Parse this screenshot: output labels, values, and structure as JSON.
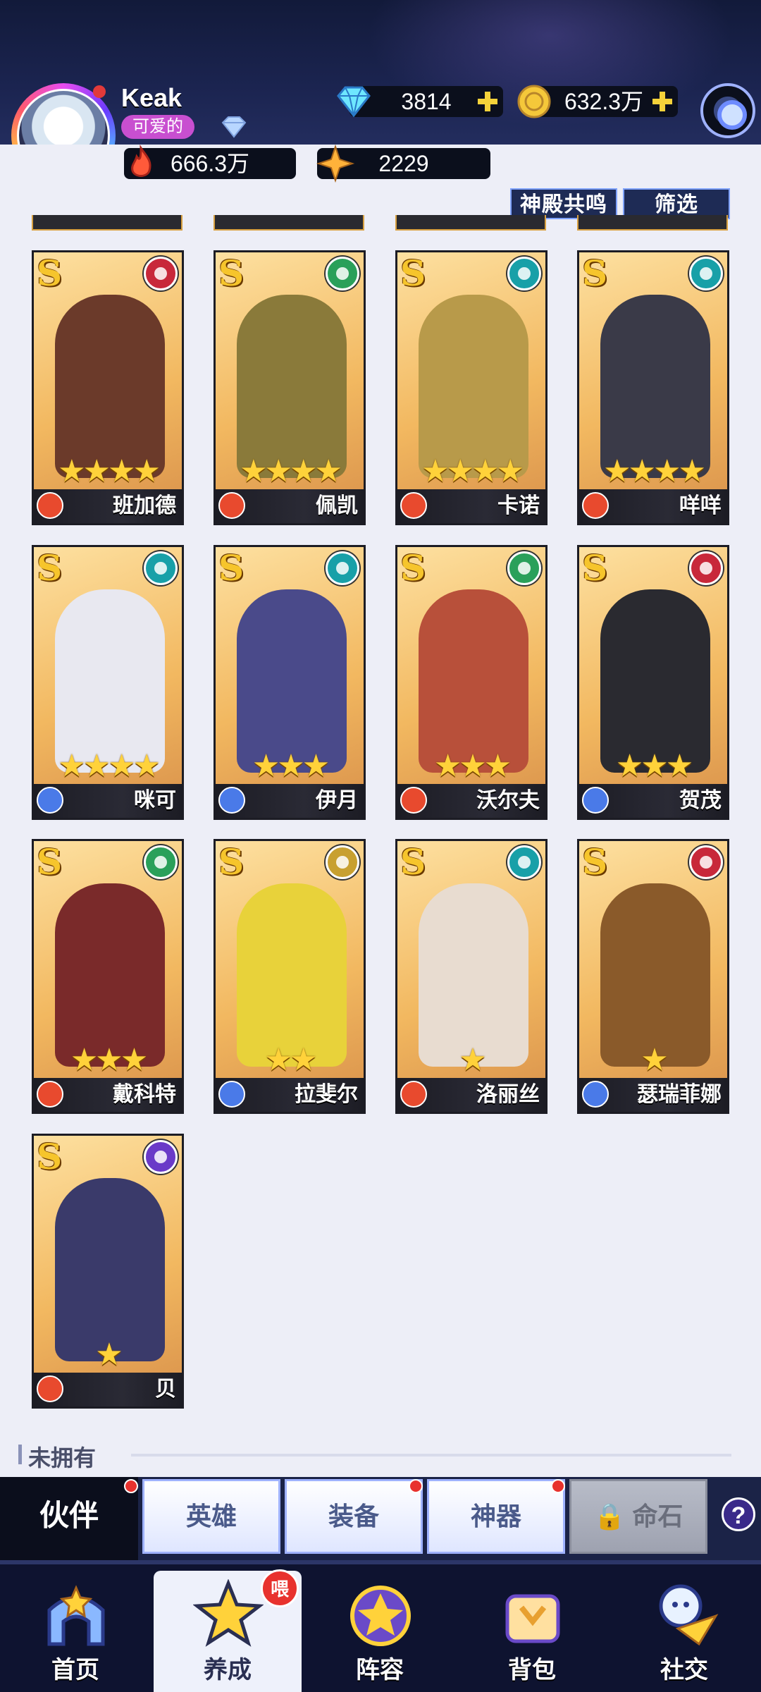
{
  "header": {
    "player_name": "Keak",
    "player_tag": "可爱的",
    "diamonds": "3814",
    "gold": "632.3万",
    "power": "666.3万",
    "crystals": "2229"
  },
  "toolbar": {
    "resonance_label": "神殿共鸣",
    "filter_label": "筛选"
  },
  "heroes": [
    {
      "name": "班加德",
      "stars": "★★★★",
      "element_color": "#c8283a",
      "class_color": "#e84a2e"
    },
    {
      "name": "佩凯",
      "stars": "★★★★",
      "element_color": "#2aa05a",
      "class_color": "#e84a2e"
    },
    {
      "name": "卡诺",
      "stars": "★★★★",
      "element_color": "#18a0a8",
      "class_color": "#e84a2e"
    },
    {
      "name": "咩咩",
      "stars": "★★★★",
      "element_color": "#18a0a8",
      "class_color": "#e84a2e"
    },
    {
      "name": "咪可",
      "stars": "★★★★",
      "element_color": "#18a0a8",
      "class_color": "#4a7ae8"
    },
    {
      "name": "伊月",
      "stars": "★★★",
      "element_color": "#18a0a8",
      "class_color": "#4a7ae8"
    },
    {
      "name": "沃尔夫",
      "stars": "★★★",
      "element_color": "#2aa05a",
      "class_color": "#e84a2e"
    },
    {
      "name": "贺茂",
      "stars": "★★★",
      "element_color": "#c8283a",
      "class_color": "#4a7ae8"
    },
    {
      "name": "戴科特",
      "stars": "★★★",
      "element_color": "#2aa05a",
      "class_color": "#e84a2e"
    },
    {
      "name": "拉斐尔",
      "stars": "★★",
      "element_color": "#c8a030",
      "class_color": "#4a7ae8"
    },
    {
      "name": "洛丽丝",
      "stars": "★",
      "element_color": "#18a0a8",
      "class_color": "#e84a2e"
    },
    {
      "name": "瑟瑞菲娜",
      "stars": "★",
      "element_color": "#c8283a",
      "class_color": "#4a7ae8"
    },
    {
      "name": "贝",
      "stars": "★",
      "element_color": "#6a3ac8",
      "class_color": "#e84a2e"
    }
  ],
  "section": {
    "not_owned_label": "未拥有"
  },
  "tabs": {
    "partner": "伙伴",
    "hero": "英雄",
    "equipment": "装备",
    "artifact": "神器",
    "fate_stone": "命石",
    "help": "?"
  },
  "nav": {
    "home": "首页",
    "develop": "养成",
    "lineup": "阵容",
    "bag": "背包",
    "social": "社交",
    "develop_badge": "喂"
  },
  "colors": {
    "accent": "#9fb2ff",
    "topbar_bg": "#1b2450",
    "card_bg": "#f3c06a",
    "badge_red": "#e8322e"
  }
}
